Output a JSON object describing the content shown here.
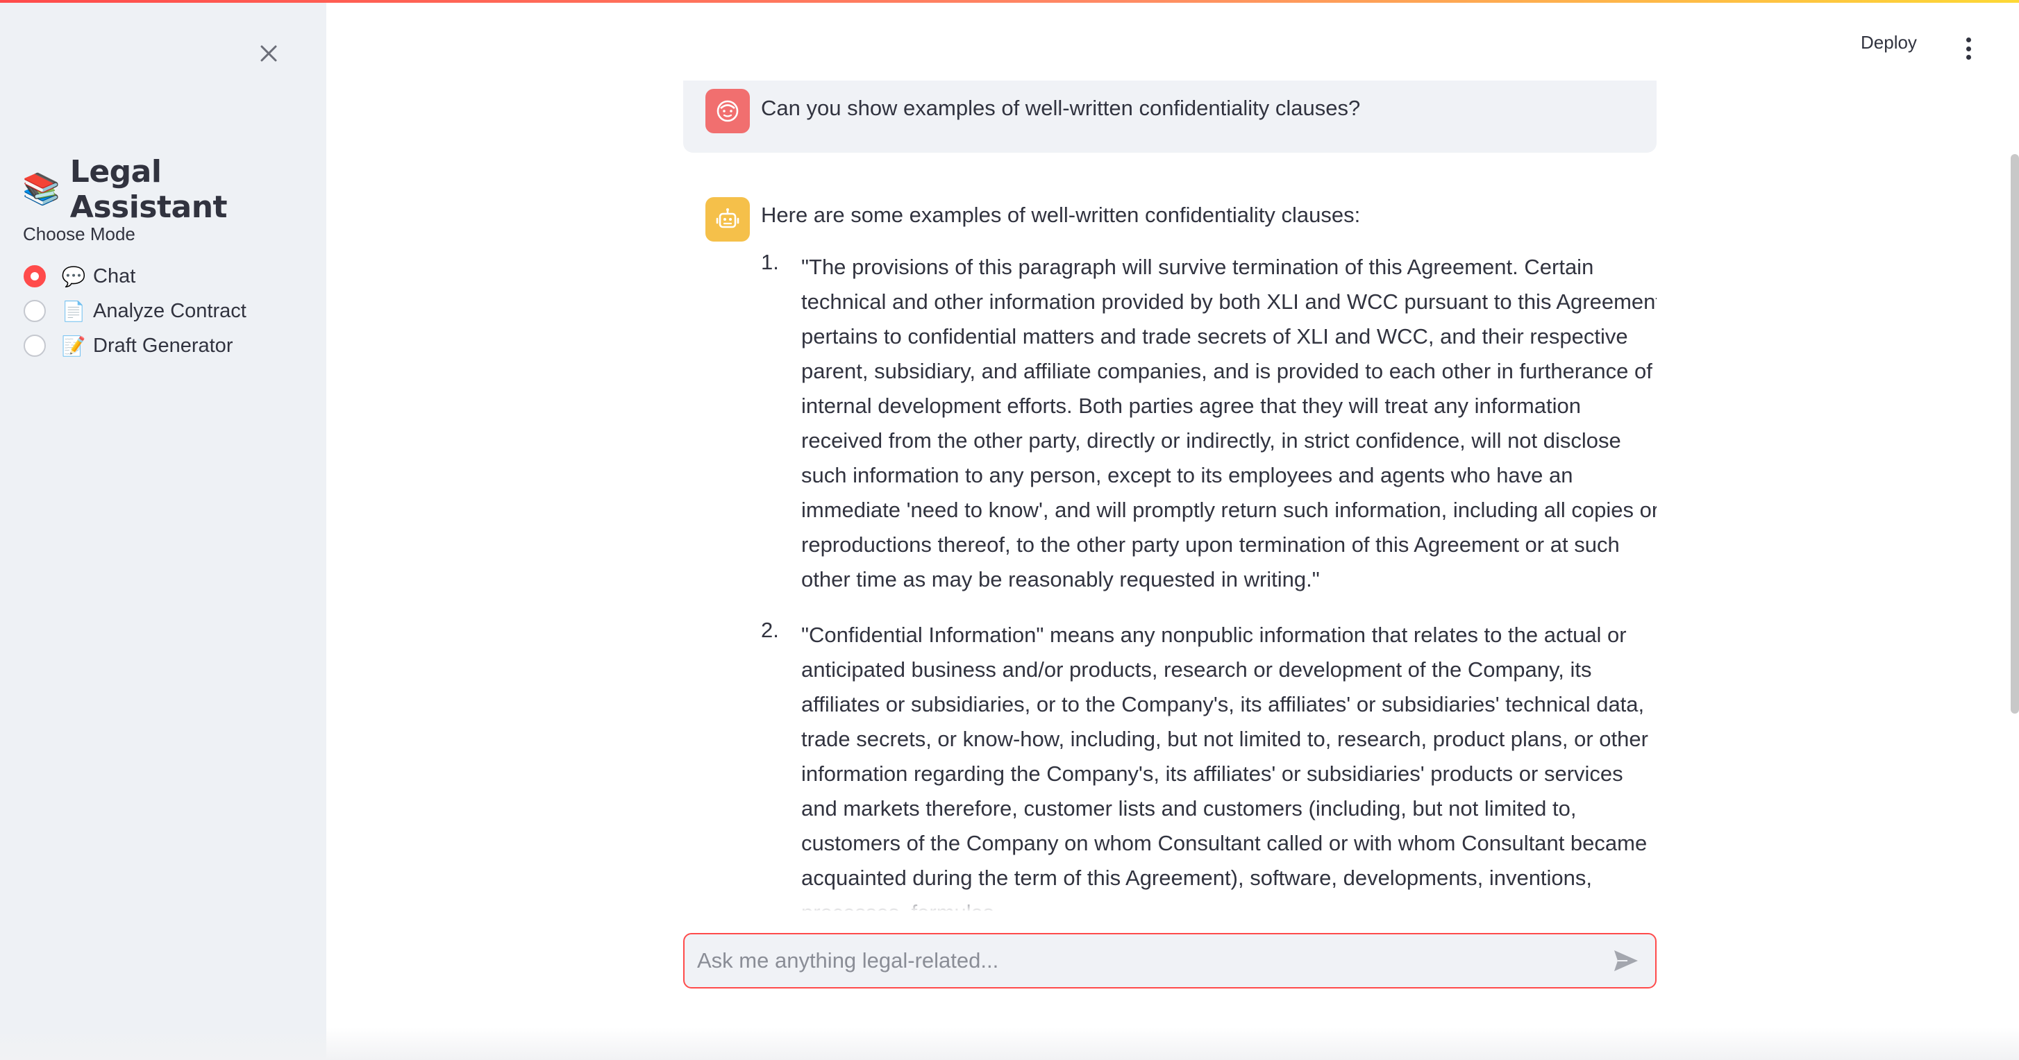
{
  "sidebar": {
    "close_icon": "close-icon",
    "title_emoji": "📚",
    "title": "Legal Assistant",
    "mode_label": "Choose Mode",
    "modes": [
      {
        "icon": "💬",
        "label": "Chat",
        "selected": true
      },
      {
        "icon": "📄",
        "label": "Analyze Contract",
        "selected": false
      },
      {
        "icon": "📝",
        "label": "Draft Generator",
        "selected": false
      }
    ]
  },
  "header": {
    "deploy_label": "Deploy",
    "menu_icon": "vertical-dots-icon"
  },
  "chat": {
    "user_message": {
      "avatar_icon": "user-face-icon",
      "text": "Can you show examples of well-written confidentiality clauses?"
    },
    "assistant_message": {
      "avatar_icon": "robot-icon",
      "intro": "Here are some examples of well-written confidentiality clauses:",
      "clauses": [
        {
          "number": "1.",
          "text": "\"The provisions of this paragraph will survive termination of this Agreement. Certain technical and other information provided by both XLI and WCC pursuant to this Agreement pertains to confidential matters and trade secrets of XLI and WCC, and their respective parent, subsidiary, and affiliate companies, and is provided to each other in furtherance of internal development efforts. Both parties agree that they will treat any information received from the other party, directly or indirectly, in strict confidence, will not disclose such information to any person, except to its employees and agents who have an immediate 'need to know', and will promptly return such information, including all copies or reproductions thereof, to the other party upon termination of this Agreement or at such other time as may be reasonably requested in writing.\""
        },
        {
          "number": "2.",
          "text": "\"Confidential Information\" means any nonpublic information that relates to the actual or anticipated business and/or products, research or development of the Company, its affiliates or subsidiaries, or to the Company's, its affiliates' or subsidiaries' technical data, trade secrets, or know-how, including, but not limited to, research, product plans, or other information regarding the Company's, its affiliates' or subsidiaries' products or services and markets therefore, customer lists and customers (including, but not limited to, customers of the Company on whom Consultant called or with whom Consultant became acquainted during the term of this Agreement), software, developments, inventions, processes, formulas,"
        }
      ]
    }
  },
  "input": {
    "placeholder": "Ask me anything legal-related...",
    "value": "",
    "send_icon": "send-icon"
  },
  "colors": {
    "accent": "#ff4b4b",
    "sidebar_bg": "#eef1f5",
    "user_avatar": "#f16f6f",
    "bot_avatar": "#f5c04a",
    "text": "#31333f"
  }
}
